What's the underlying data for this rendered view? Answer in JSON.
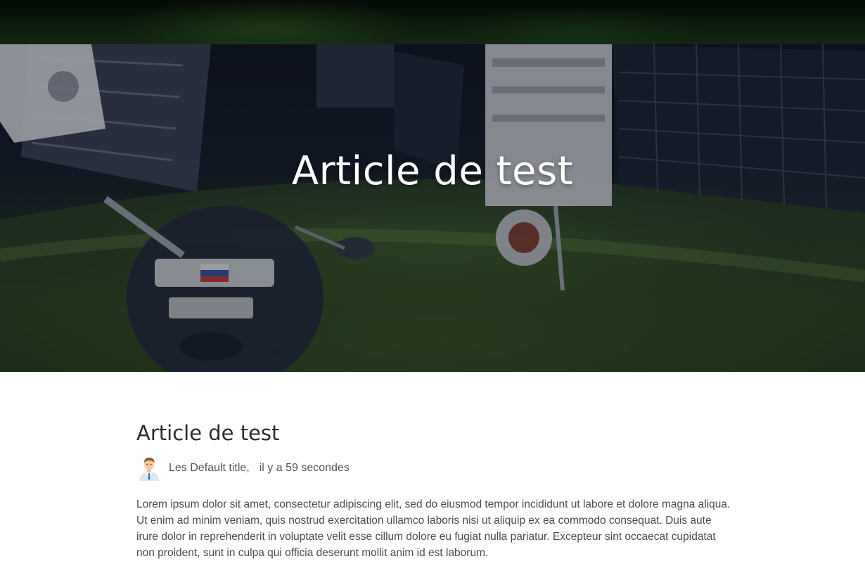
{
  "hero": {
    "title": "Article de test"
  },
  "article": {
    "title": "Article de test",
    "author": "Les Default title,",
    "time": "il y a 59 secondes",
    "body": "Lorem ipsum dolor sit amet, consectetur adipiscing elit, sed do eiusmod tempor incididunt ut labore et dolore magna aliqua. Ut enim ad minim veniam, quis nostrud exercitation ullamco laboris nisi ut aliquip ex ea commodo consequat. Duis aute irure dolor in reprehenderit in voluptate velit esse cillum dolore eu fugiat nulla pariatur. Excepteur sint occaecat cupidatat non proident, sunt in culpa qui officia deserunt mollit anim id est laborum."
  },
  "icons": {
    "avatar": "user-avatar-icon"
  },
  "colors": {
    "title_text": "#2b2b2b",
    "body_text": "#4a4a4a",
    "hero_text": "#ffffff"
  }
}
